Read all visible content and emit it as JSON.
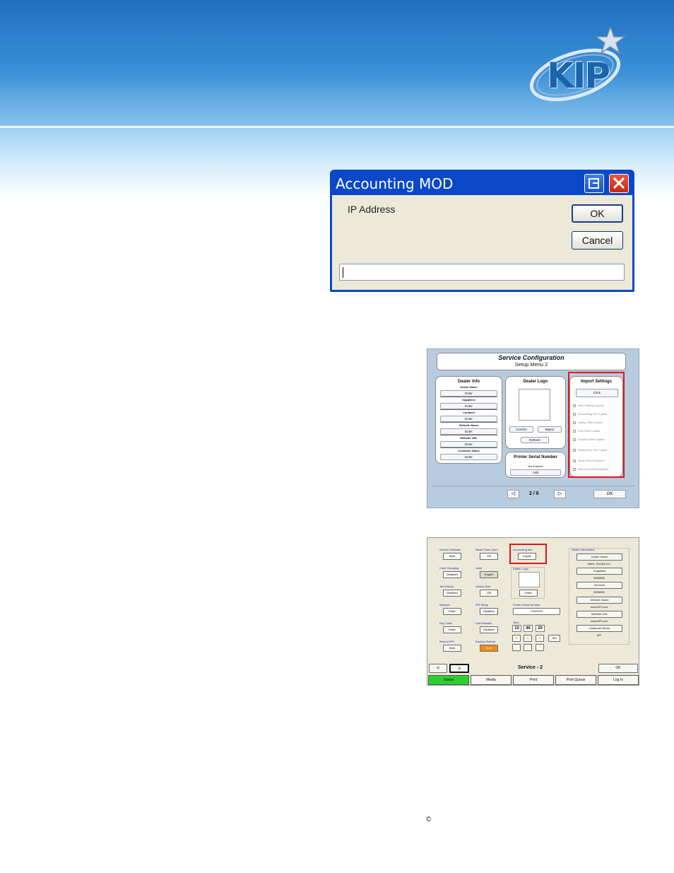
{
  "header": {
    "logo_text": "KIP",
    "colors": {
      "banner_dark": "#1f6fbe",
      "banner_light": "#6db5ea",
      "logo_blue": "#1a64ad"
    }
  },
  "accounting_dialog": {
    "title": "Accounting MOD",
    "label": "IP Address",
    "ok_label": "OK",
    "cancel_label": "Cancel",
    "input_value": "",
    "title_bar_color": "#0b48c8"
  },
  "service_config": {
    "title": "Service Configuration",
    "subtitle": "Setup Menu 2",
    "dealer_info": {
      "title": "Dealer Info",
      "fields": [
        {
          "label": "Dealer Name",
          "button": "Enter"
        },
        {
          "label": "Supplies#",
          "button": "Enter"
        },
        {
          "label": "Contact#",
          "button": "Enter"
        },
        {
          "label": "Website Name",
          "button": "Enter"
        },
        {
          "label": "Website URL",
          "button": "Enter"
        },
        {
          "label": "Customer Name",
          "button": "Enter"
        }
      ]
    },
    "dealer_logo": {
      "title": "Dealer Logo",
      "confirm": "Confirm",
      "reject": "Reject",
      "refresh": "Refresh"
    },
    "printer_serial": {
      "title": "Printer Serial Number",
      "value": "Not Entered",
      "button": "Add"
    },
    "import_settings": {
      "title": "Import Settings",
      "button": "Click",
      "checks": [
        "New Settings Saved",
        "Accounting File Copied",
        "Stamp Files Copied",
        "Fold Files Copied",
        "Graphic Files Copied",
        "Default Per File Copied",
        "Temp Files Removed",
        "New Accounting Applied"
      ]
    },
    "pager": {
      "prev": "◁",
      "page": "2 / 6",
      "next": "▷"
    },
    "ok_label": "OK",
    "highlight_color": "#e0141c"
  },
  "service2": {
    "col1": [
      {
        "label": "Service Software",
        "button": "Start"
      },
      {
        "label": "Color Grouping",
        "button": "Disabled"
      },
      {
        "label": "Job History",
        "button": "Disabled"
      },
      {
        "label": "Network",
        "button": "Enter"
      },
      {
        "label": "Key Code",
        "button": "Enter"
      },
      {
        "label": "Reboot IPS",
        "button": "Start"
      }
    ],
    "col2": [
      {
        "label": "Reset Timer (min)",
        "button": "Off"
      },
      {
        "label": "Units",
        "button": "English"
      },
      {
        "label": "History Size",
        "button": "Off"
      },
      {
        "label": "IPS Setup",
        "button": "Disabled"
      },
      {
        "label": "Card Reader",
        "button": "Disabled"
      },
      {
        "label": "Factory Restore",
        "button": "Start"
      }
    ],
    "accounting_info": {
      "label": "Accounting Info",
      "button": "Import"
    },
    "dealer_logo": {
      "label": "Dealer Logo",
      "button": "Enter"
    },
    "printer_serial": {
      "label": "Printer Serial Number",
      "value": "12345000"
    },
    "time": {
      "label": "Time",
      "hours": "10",
      "minutes": "46",
      "seconds": "20",
      "up": "+",
      "down": "-",
      "set": "Set"
    },
    "dealer_information": {
      "title": "Dealer Information",
      "entries": [
        {
          "button": "Dealer Name",
          "value": "Sales, Service Inc."
        },
        {
          "button": "Supplies#",
          "value": "5555555"
        },
        {
          "button": "Service#",
          "value": "5555555"
        },
        {
          "button": "Website Name",
          "value": "www.KIP.com"
        },
        {
          "button": "Website URL",
          "value": "www.KIP.com"
        },
        {
          "button": "Customer Name",
          "value": "KIP"
        }
      ]
    },
    "nav": {
      "prev": "<",
      "next": ">",
      "title": "Service - 2",
      "ok": "OK"
    },
    "tabs": [
      "Status",
      "Media",
      "Print",
      "Print Queue",
      "Log In"
    ]
  },
  "footer": {
    "copyright_symbol": "©"
  }
}
